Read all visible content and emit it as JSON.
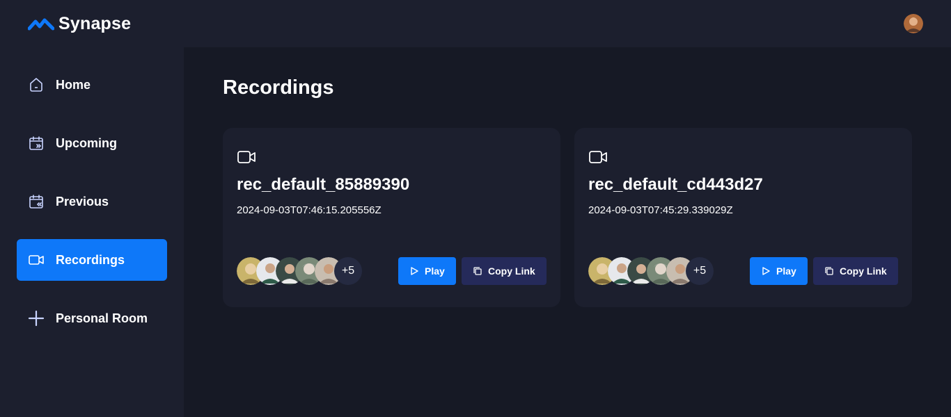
{
  "brand": {
    "name": "Synapse",
    "accent": "#0e78f9"
  },
  "nav": [
    {
      "label": "Home",
      "icon": "home-icon",
      "active": false
    },
    {
      "label": "Upcoming",
      "icon": "calendar-forward-icon",
      "active": false
    },
    {
      "label": "Previous",
      "icon": "calendar-back-icon",
      "active": false
    },
    {
      "label": "Recordings",
      "icon": "video-icon",
      "active": true
    },
    {
      "label": "Personal Room",
      "icon": "plus-icon",
      "active": false
    }
  ],
  "page": {
    "title": "Recordings"
  },
  "cards": [
    {
      "title": "rec_default_85889390",
      "date": "2024-09-03T07:46:15.205556Z",
      "more_count": "+5",
      "play_label": "Play",
      "copy_label": "Copy Link"
    },
    {
      "title": "rec_default_cd443d27",
      "date": "2024-09-03T07:45:29.339029Z",
      "more_count": "+5",
      "play_label": "Play",
      "copy_label": "Copy Link"
    }
  ]
}
